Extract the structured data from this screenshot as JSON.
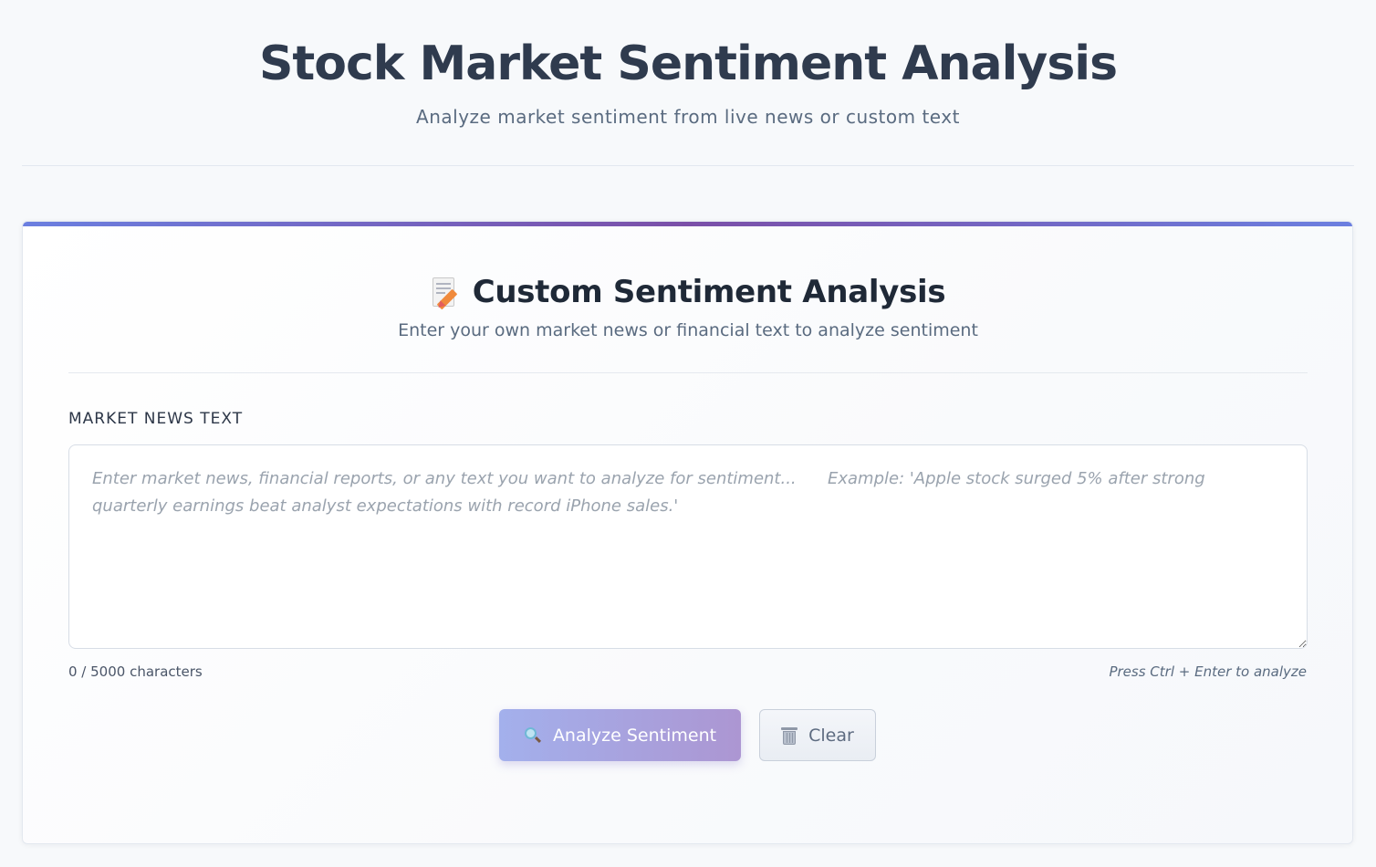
{
  "header": {
    "title": "Stock Market Sentiment Analysis",
    "subtitle": "Analyze market sentiment from live news or custom text"
  },
  "card": {
    "icon": "memo-icon",
    "title": "Custom Sentiment Analysis",
    "subtitle": "Enter your own market news or financial text to analyze sentiment",
    "field_label": "MARKET NEWS TEXT",
    "textarea": {
      "value": "",
      "placeholder": "Enter market news, financial reports, or any text you want to analyze for sentiment...      Example: 'Apple stock surged 5% after strong quarterly earnings beat analyst expectations with record iPhone sales.'"
    },
    "char_count": "0 / 5000 characters",
    "hint": "Press Ctrl + Enter to analyze",
    "buttons": {
      "analyze": {
        "label": "Analyze Sentiment",
        "icon": "search-icon"
      },
      "clear": {
        "label": "Clear",
        "icon": "trash-icon"
      }
    }
  },
  "colors": {
    "accent_start": "#6b7fe0",
    "accent_mid": "#7b4fa8",
    "analyze_button_start": "#a3b0ec",
    "analyze_button_end": "#ac96d2",
    "background": "#f7f9fb"
  }
}
